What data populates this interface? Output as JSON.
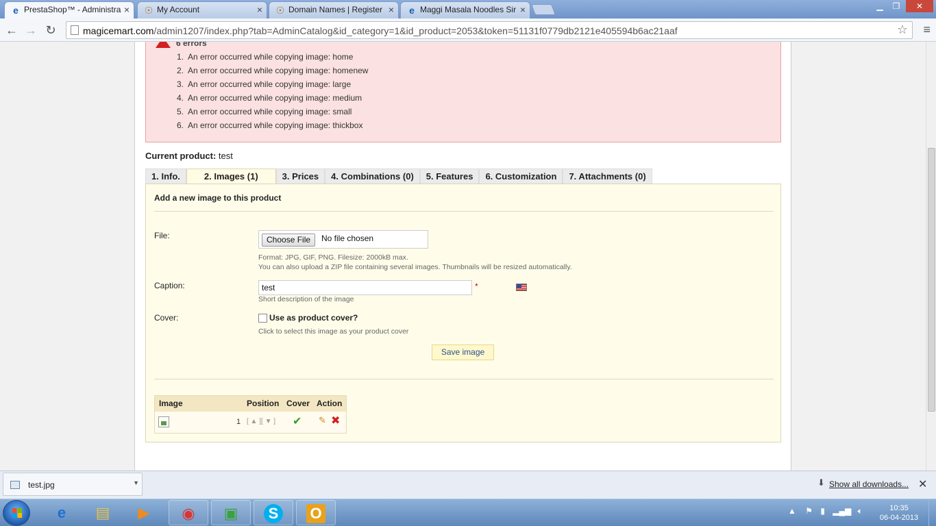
{
  "browser": {
    "tabs": [
      {
        "title": "PrestaShop™ - Administra",
        "active": true
      },
      {
        "title": "My Account",
        "active": false
      },
      {
        "title": "Domain Names | Register",
        "active": false
      },
      {
        "title": "Maggi Masala Noodles Sir",
        "active": false
      }
    ],
    "url_host": "magicemart.com",
    "url_path": "/admin1207/index.php?tab=AdminCatalog&id_category=1&id_product=2053&token=51131f0779db2121e405594b6ac21aaf"
  },
  "errors": {
    "title": "6 errors",
    "items": [
      {
        "num": "1.",
        "text": "An error occurred while copying image: home"
      },
      {
        "num": "2.",
        "text": "An error occurred while copying image: homenew"
      },
      {
        "num": "3.",
        "text": "An error occurred while copying image: large"
      },
      {
        "num": "4.",
        "text": "An error occurred while copying image: medium"
      },
      {
        "num": "5.",
        "text": "An error occurred while copying image: small"
      },
      {
        "num": "6.",
        "text": "An error occurred while copying image: thickbox"
      }
    ]
  },
  "product": {
    "label": "Current product:",
    "name": "test"
  },
  "product_tabs": [
    {
      "label": "1. Info.",
      "active": false
    },
    {
      "label": "2. Images (1)",
      "active": true
    },
    {
      "label": "3. Prices",
      "active": false
    },
    {
      "label": "4. Combinations (0)",
      "active": false
    },
    {
      "label": "5. Features",
      "active": false
    },
    {
      "label": "6. Customization",
      "active": false
    },
    {
      "label": "7. Attachments (0)",
      "active": false
    }
  ],
  "form": {
    "title": "Add a new image to this product",
    "file_label": "File:",
    "choose_file": "Choose File",
    "no_file": "No file chosen",
    "format_hint": "Format: JPG, GIF, PNG. Filesize: 2000kB max.",
    "zip_hint": "You can also upload a ZIP file containing several images. Thumbnails will be resized automatically.",
    "caption_label": "Caption:",
    "caption_value": "test",
    "required_mark": "*",
    "caption_hint": "Short description of the image",
    "cover_label": "Cover:",
    "cover_checkbox": "Use as product cover?",
    "cover_hint": "Click to select this image as your product cover",
    "save_button": "Save image"
  },
  "image_table": {
    "headers": [
      "Image",
      "Position",
      "Cover",
      "Action"
    ],
    "rows": [
      {
        "position": "1",
        "position_controls": "[ ▲ ][ ▼ ]",
        "is_cover": true
      }
    ]
  },
  "downloads": {
    "file": "test.jpg",
    "show_all": "Show all downloads..."
  },
  "taskbar": {
    "time": "10:35",
    "date": "06-04-2013"
  },
  "colors": {
    "error_bg": "#fbe1e1",
    "panel_bg": "#fffdea",
    "link": "#2a4f8f"
  }
}
